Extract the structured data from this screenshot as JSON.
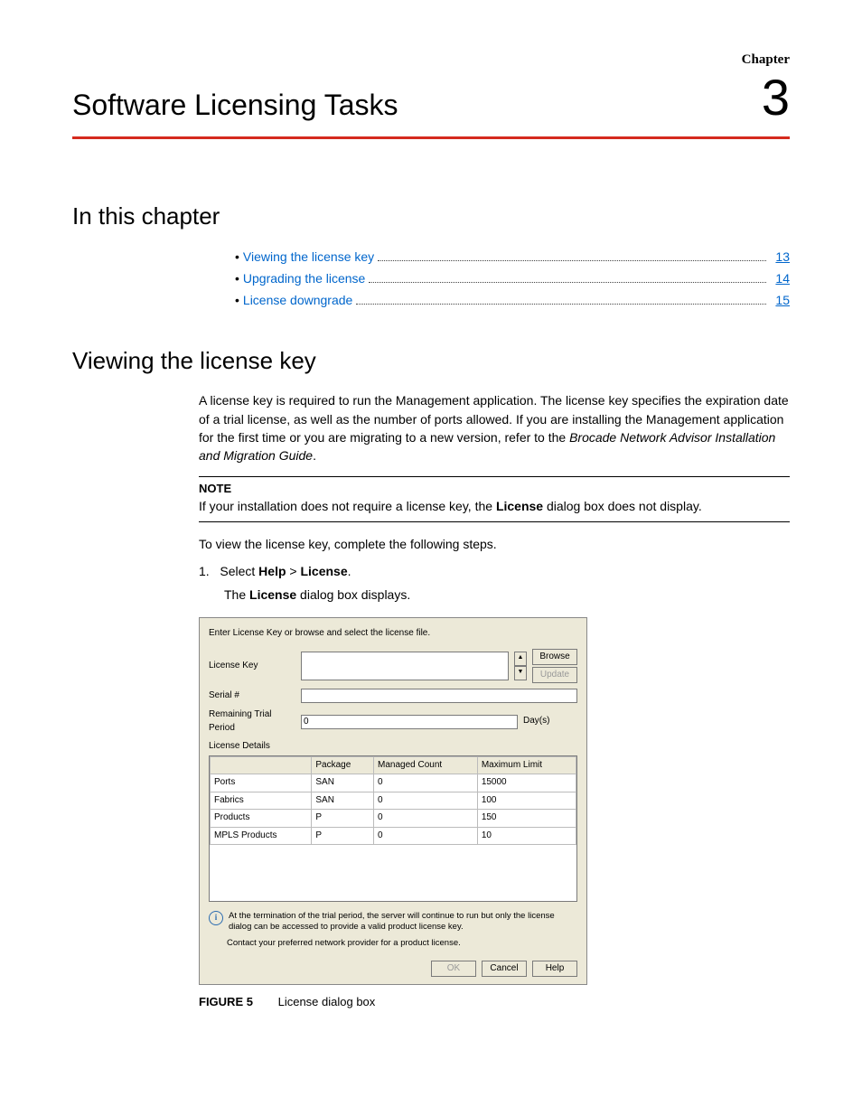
{
  "header": {
    "chapter_label": "Chapter",
    "chapter_number": "3",
    "chapter_title": "Software Licensing Tasks"
  },
  "sections": {
    "in_this_chapter": "In this chapter",
    "viewing": "Viewing the license key"
  },
  "toc": [
    {
      "label": "Viewing the license key",
      "page": "13"
    },
    {
      "label": "Upgrading the license",
      "page": "14"
    },
    {
      "label": "License downgrade",
      "page": "15"
    }
  ],
  "body": {
    "para1_a": "A license key is required to run the Management application. The license key specifies the expiration date of a trial license, as well as the number of ports allowed. If you are installing the Management application for the first time or you are migrating to a new version, refer to the ",
    "para1_italic": "Brocade Network Advisor Installation and Migration Guide",
    "para1_b": ".",
    "note_label": "NOTE",
    "note_a": "If your installation does not require a license key, the ",
    "note_bold": "License",
    "note_b": " dialog box does not display.",
    "para2": "To view the license key, complete the following steps.",
    "step1_num": "1.",
    "step1_a": "Select ",
    "step1_b1": "Help",
    "step1_sep": " > ",
    "step1_b2": "License",
    "step1_c": ".",
    "step1_sub_a": "The ",
    "step1_sub_bold": "License",
    "step1_sub_b": " dialog box displays."
  },
  "dialog": {
    "instruction": "Enter License Key or browse and select the license file.",
    "labels": {
      "license_key": "License Key",
      "serial": "Serial #",
      "remaining": "Remaining Trial Period",
      "remaining_value": "0",
      "days": "Day(s)",
      "details": "License Details"
    },
    "buttons": {
      "browse": "Browse",
      "update": "Update",
      "ok": "OK",
      "cancel": "Cancel",
      "help": "Help"
    },
    "table": {
      "headers": [
        "",
        "Package",
        "Managed Count",
        "Maximum Limit"
      ],
      "rows": [
        [
          "Ports",
          "SAN",
          "0",
          "15000"
        ],
        [
          "Fabrics",
          "SAN",
          "0",
          "100"
        ],
        [
          "Products",
          "P",
          "0",
          "150"
        ],
        [
          "MPLS Products",
          "P",
          "0",
          "10"
        ]
      ]
    },
    "info1": "At the termination of the trial period, the server will continue to run but only the license dialog can be accessed to provide a valid product license key.",
    "info2": "Contact your preferred network provider for a product license."
  },
  "figure": {
    "label": "FIGURE 5",
    "caption": "License dialog box"
  }
}
